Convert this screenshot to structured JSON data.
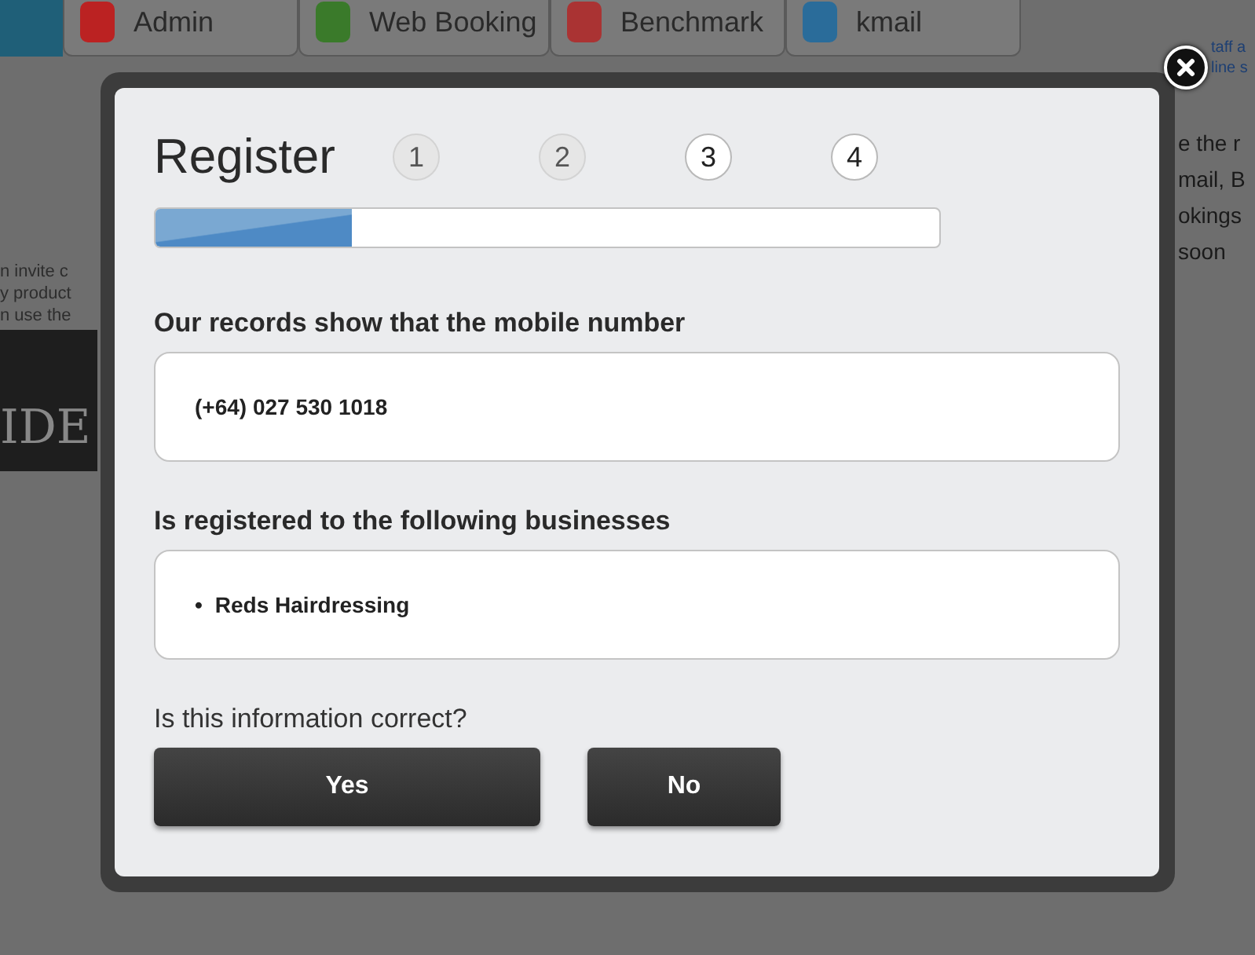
{
  "background": {
    "tiles": [
      {
        "label": "Admin"
      },
      {
        "label": "Web Booking"
      },
      {
        "label": "Benchmark"
      },
      {
        "label": "kmail"
      }
    ],
    "left_lines": [
      "n invite c",
      "y product",
      "n use the"
    ],
    "banner": "IDE",
    "right_link_lines": [
      "taff a",
      "line s"
    ],
    "right_lines": [
      "e the r",
      "mail, B",
      "okings",
      "soon"
    ]
  },
  "dialog": {
    "title": "Register",
    "steps": [
      {
        "label": "1",
        "completed": true
      },
      {
        "label": "2",
        "completed": true
      },
      {
        "label": "3",
        "completed": false
      },
      {
        "label": "4",
        "completed": false
      }
    ],
    "progress": {
      "level": 0.25
    },
    "mobile_heading": "Our records show that the mobile number",
    "mobile_number": "(+64) 027 530 1018",
    "businesses_heading": "Is registered to the following businesses",
    "business_marker": "•",
    "businesses": [
      "Reds Hairdressing"
    ],
    "question": "Is this information correct?",
    "buttons": [
      {
        "label": "Yes",
        "kind": "wide"
      },
      {
        "label": "No",
        "kind": "narrow"
      }
    ]
  }
}
